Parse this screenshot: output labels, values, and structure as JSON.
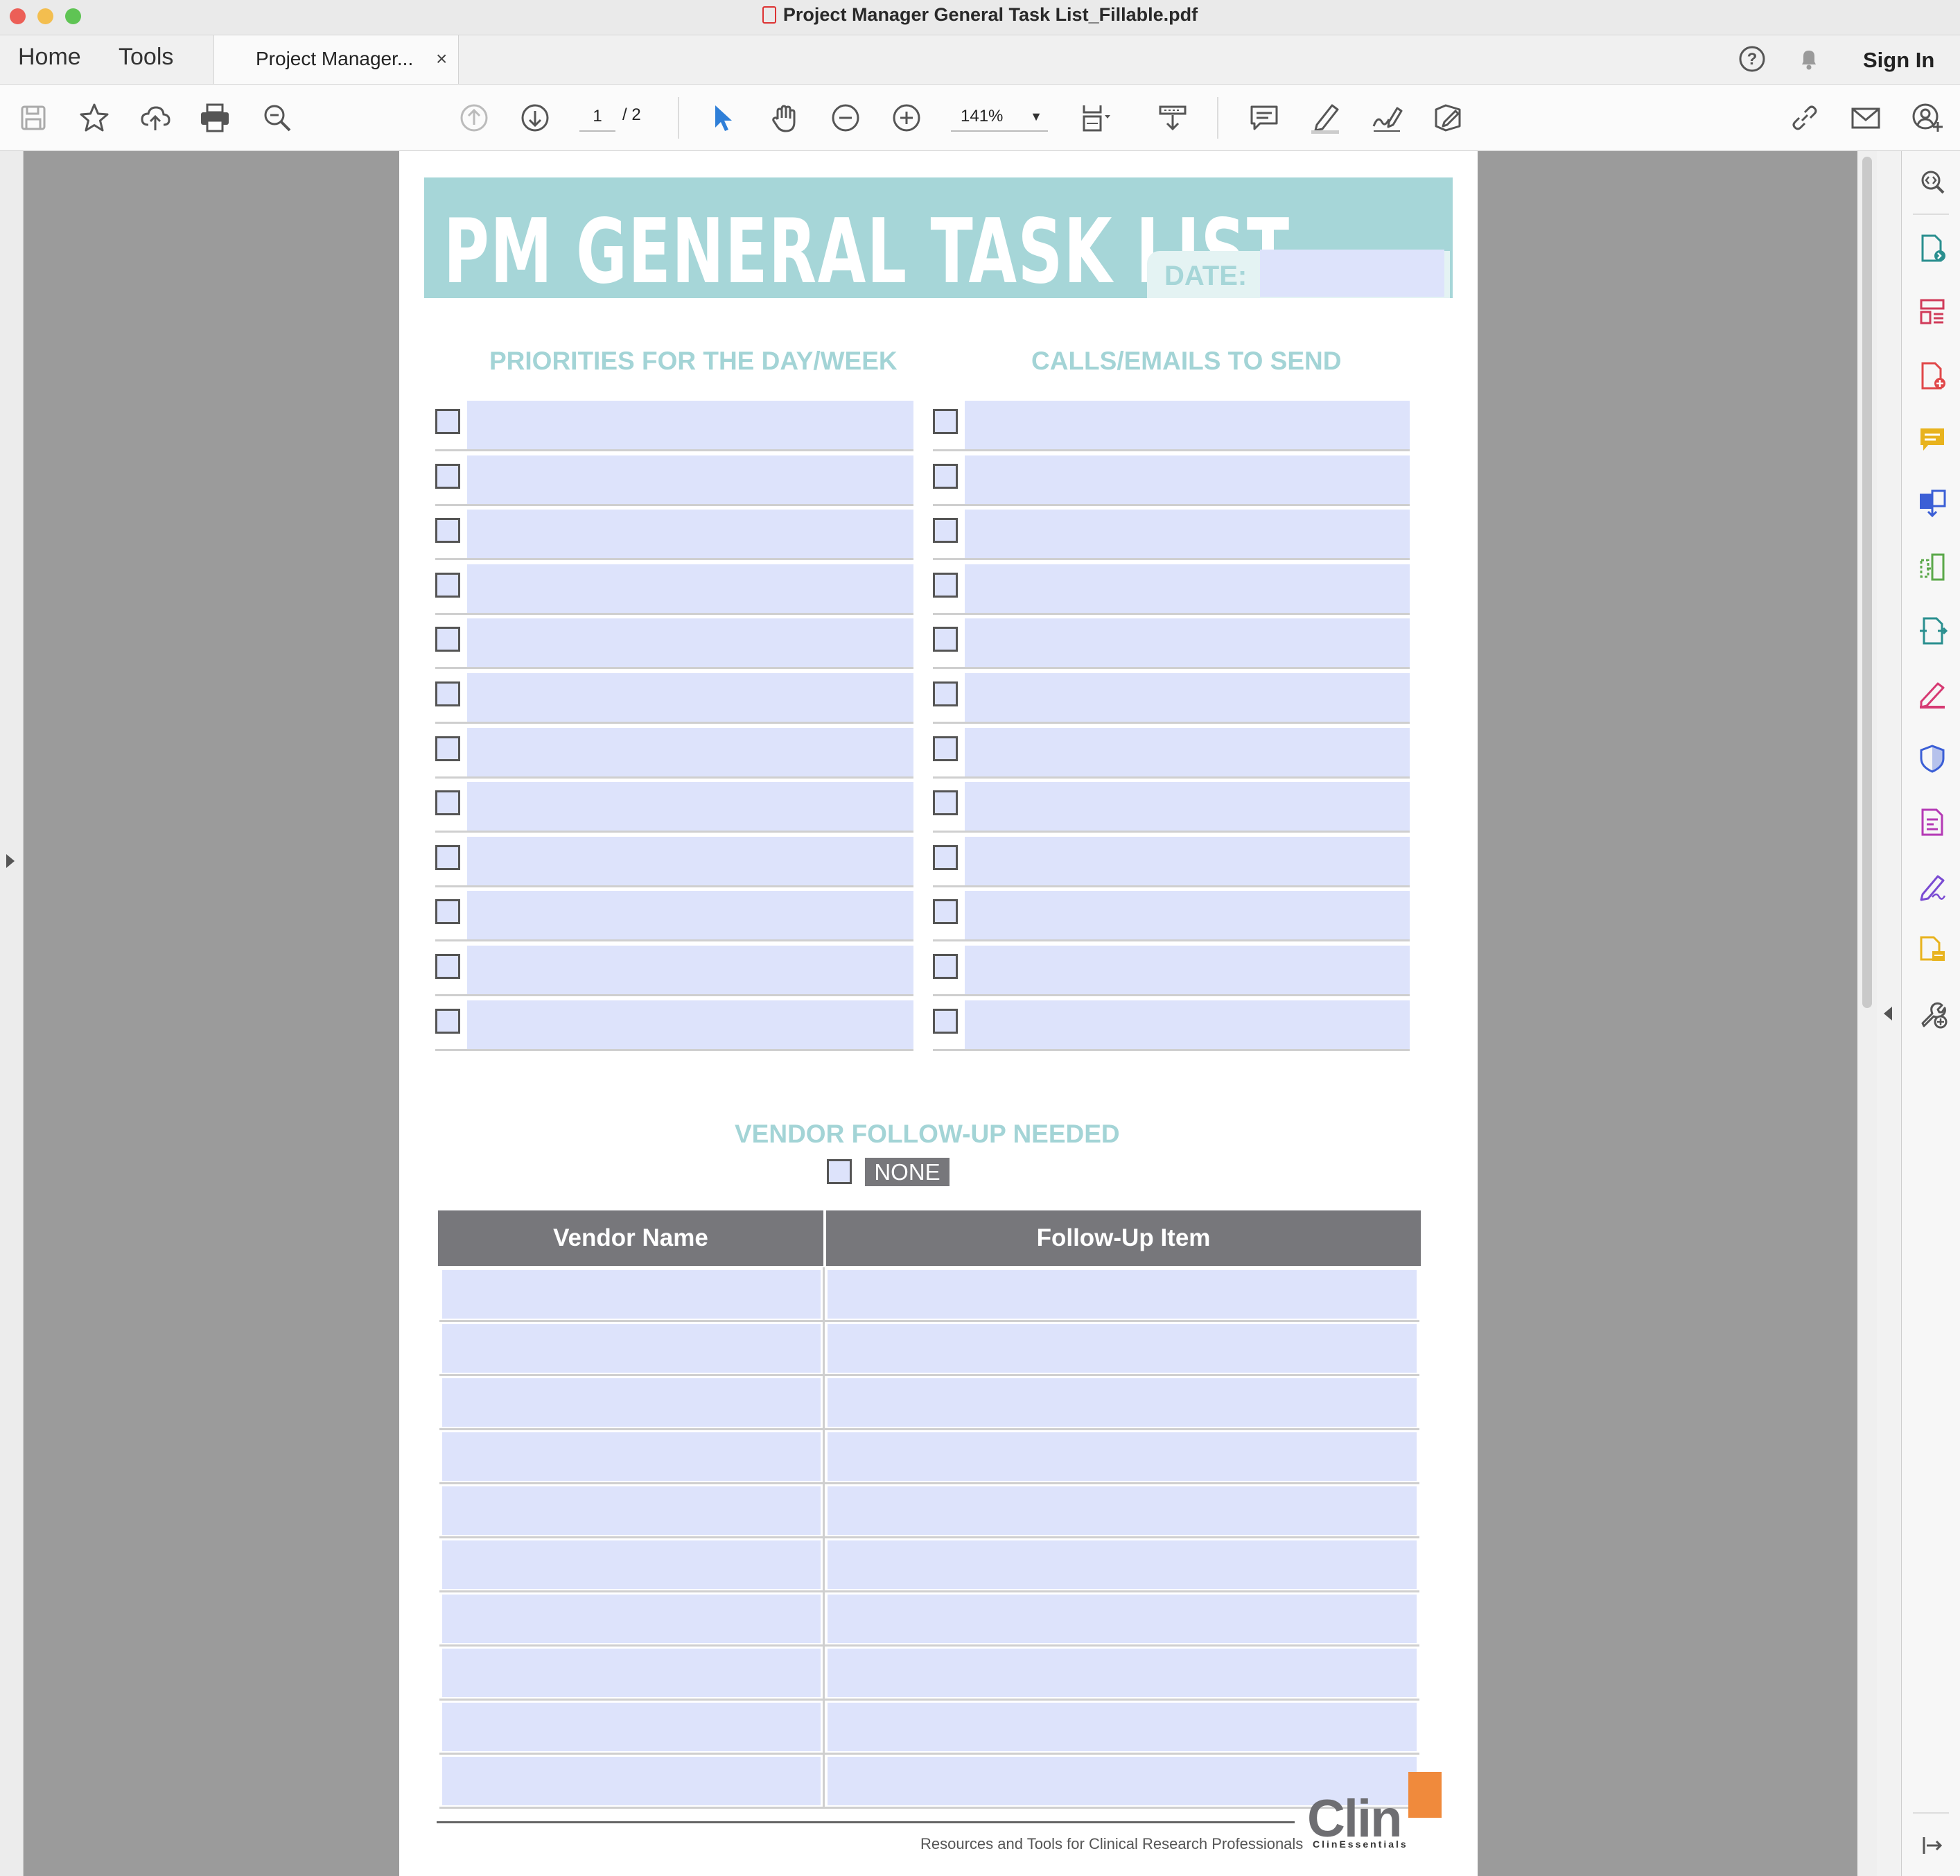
{
  "window": {
    "title": "Project Manager General Task List_Fillable.pdf"
  },
  "tabs": {
    "home": "Home",
    "tools": "Tools",
    "document_tab": "Project Manager...",
    "close": "×",
    "sign_in": "Sign In"
  },
  "toolbar": {
    "page_current": "1",
    "page_total": "/ 2",
    "zoom": "141%",
    "icons": [
      "save-icon",
      "bookmark-star-icon",
      "upload-cloud-icon",
      "print-icon",
      "find-icon",
      "page-up-icon",
      "page-down-icon",
      "select-cursor-icon",
      "hand-icon",
      "zoom-out-icon",
      "zoom-in-icon",
      "fit-page-icon",
      "scroll-mode-icon",
      "comment-icon",
      "highlight-icon",
      "sign-icon",
      "fill-sign-icon",
      "share-link-icon",
      "email-icon",
      "add-user-icon"
    ],
    "accent": "#2f7fd8"
  },
  "right_panel": {
    "icons": [
      "search-zoom-icon",
      "export-pdf-icon",
      "organize-pages-icon",
      "create-pdf-icon",
      "comment-tool-icon",
      "combine-files-icon",
      "compress-icon",
      "send-review-icon",
      "fill-sign-tool-icon",
      "protect-icon",
      "prepare-form-icon",
      "sign-tool-icon",
      "send-for-signature-icon",
      "more-tools-icon",
      "collapse-panel-icon"
    ]
  },
  "document": {
    "title": "PM GENERAL TASK LIST",
    "date_label": "DATE:",
    "priorities_heading": "PRIORITIES FOR THE DAY/WEEK",
    "calls_heading": "CALLS/EMAILS TO SEND",
    "checklist_rows": 12,
    "vendor_heading": "VENDOR FOLLOW-UP NEEDED",
    "none_label": "NONE",
    "table": {
      "col1": "Vendor Name",
      "col2": "Follow-Up Item",
      "rows": 10
    },
    "footer_text": "Resources and Tools for Clinical Research Professionals",
    "logo_text": "Clin",
    "logo_subtext": "ClinEssentials"
  },
  "colors": {
    "banner": "#a6d6d8",
    "field": "#dde3fb",
    "header_gray": "#77777b",
    "logo_orange": "#f08a3c"
  }
}
